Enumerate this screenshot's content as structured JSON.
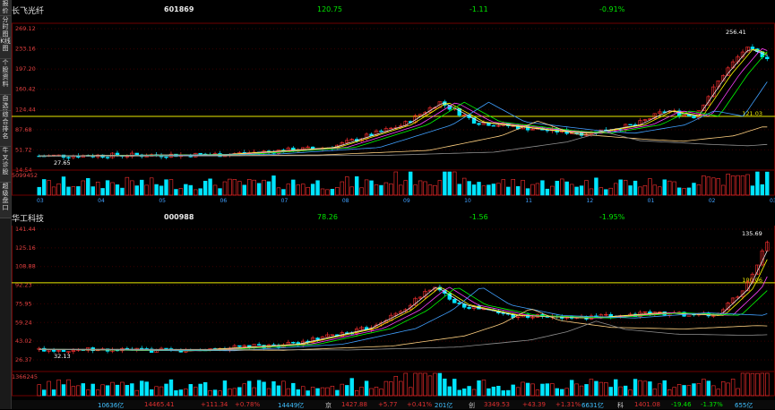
{
  "sidebar": {
    "items": [
      "报价",
      "分时图",
      "K线图",
      "个股资料",
      "自选股",
      "综合排名",
      "牛叉诊股",
      "超级盘口"
    ]
  },
  "panel1": {
    "name": "长飞光纤",
    "code": "601869",
    "price": "120.75",
    "change": "-1.11",
    "change_pct": "-0.91%",
    "price_ticks": [
      "269.12",
      "233.16",
      "197.20",
      "160.42",
      "124.44",
      "87.68",
      "51.72",
      "14.54"
    ],
    "high_label": "256.41",
    "low_label": "27.65",
    "ref_label": "121.03",
    "volume_label": "5099452",
    "date_ticks": [
      "03",
      "04",
      "05",
      "06",
      "07",
      "08",
      "09",
      "10",
      "11",
      "12",
      "01",
      "02",
      "03"
    ]
  },
  "panel2": {
    "name": "华工科技",
    "code": "000988",
    "price": "78.26",
    "change": "-1.56",
    "change_pct": "-1.95%",
    "price_ticks": [
      "141.44",
      "125.16",
      "108.88",
      "92.23",
      "75.95",
      "59.24",
      "43.02",
      "26.37"
    ],
    "high_label": "135.69",
    "low_label": "32.13",
    "ref_label": "100.06",
    "volume_label": "1366245"
  },
  "statusbar": {
    "items": [
      "10636亿",
      "14465.41",
      "+111.34",
      "+0.78%",
      "14449亿",
      "京",
      "1427.88",
      "+5.77",
      "+0.41%",
      "201亿",
      "创",
      "3349.53",
      "+43.39",
      "+1.31%",
      "6631亿",
      "科",
      "1401.08",
      "-19.46",
      "-1.37%",
      "655亿"
    ]
  },
  "colors": {
    "up": "#ff3030",
    "down": "#00e5ff",
    "ma5": "#e8e8e8",
    "ma10": "#ffff00",
    "ma20": "#ff40ff",
    "ma30": "#00ff00",
    "ma60": "#40a0ff",
    "ma120": "#ffd080",
    "ma250": "#909090",
    "refline": "#e8e800"
  }
}
